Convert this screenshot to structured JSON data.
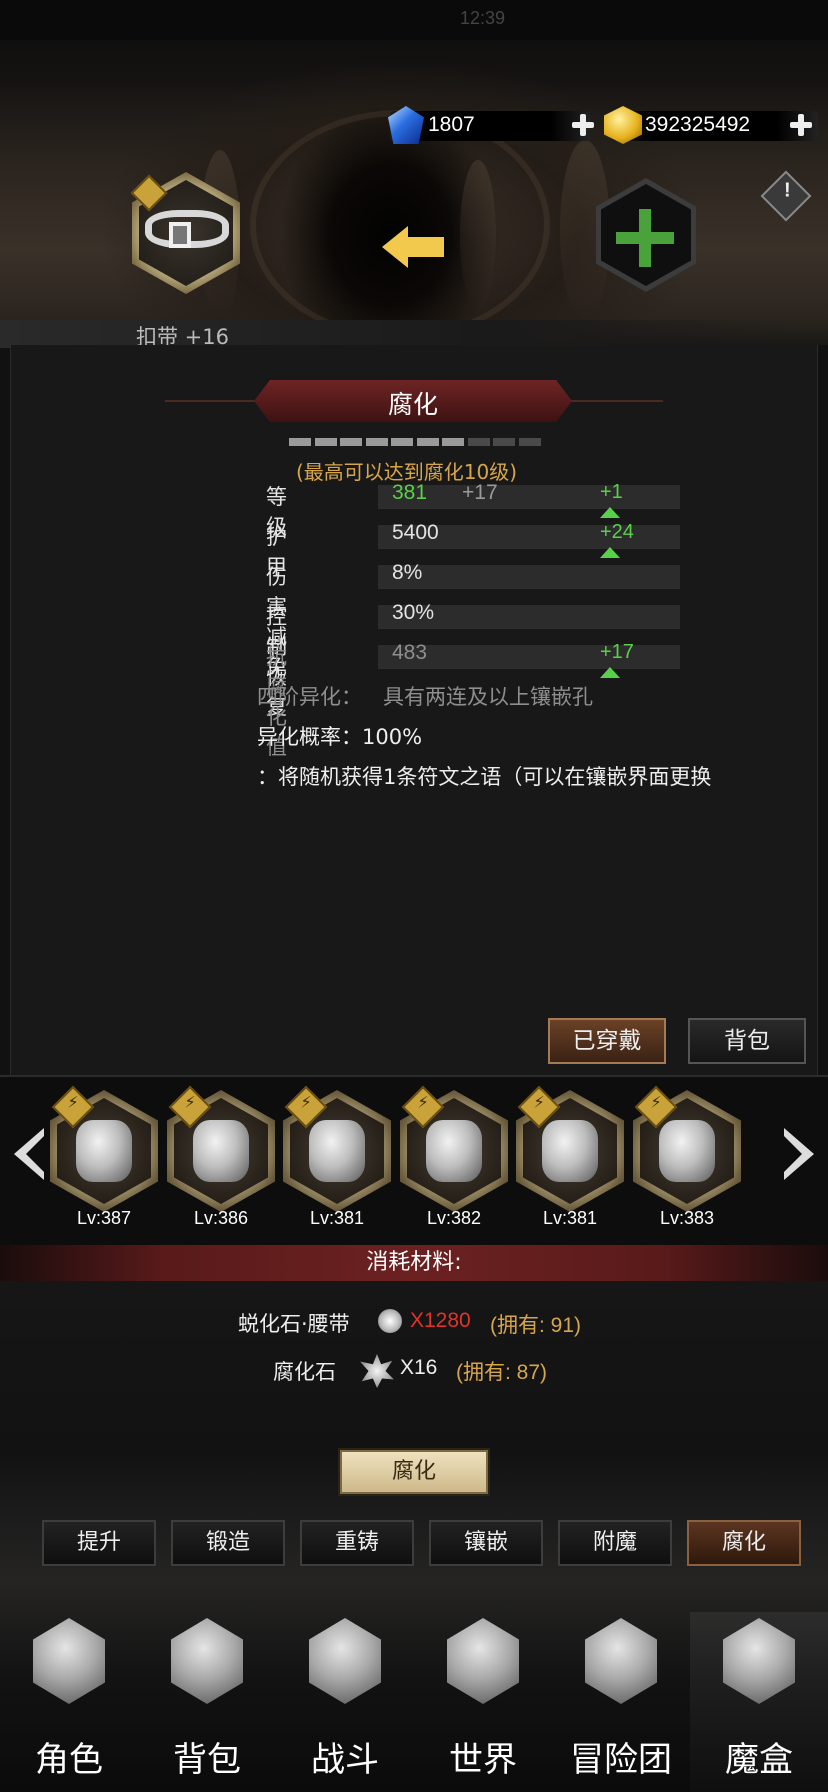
{
  "status_bar": {
    "time": "12:39"
  },
  "resources": {
    "gems": {
      "value": "1807",
      "icon": "blue-gem-icon"
    },
    "gold": {
      "value": "392325492",
      "icon": "gold-gem-icon"
    }
  },
  "equipment": {
    "name": "扣带 +16",
    "action_arrow": "left-arrow-icon",
    "add_slot": "plus-icon",
    "info": "info-icon"
  },
  "panel": {
    "title": "腐化",
    "progress": {
      "filled": 7,
      "total": 10
    },
    "max_note": "(最高可以达到腐化10级)",
    "stats": [
      {
        "label": "等级",
        "value": "381",
        "bonus": "+17",
        "up": "+1"
      },
      {
        "label": "护甲",
        "value": "5400",
        "bonus": "",
        "up": "+24"
      },
      {
        "label": "伤害减免",
        "value": "8%",
        "bonus": "",
        "up": ""
      },
      {
        "label": "控制恢复",
        "value": "30%",
        "bonus": "",
        "up": ""
      },
      {
        "label": "抗腐化值",
        "value": "483",
        "bonus": "",
        "up": "+17"
      }
    ],
    "mutation_stage": "四阶异化：",
    "mutation_req": "具有两连及以上镶嵌孔",
    "mutation_rate": "异化概率：100%",
    "mutation_desc": "：将随机获得1条符文之语（可以在镶嵌界面更换",
    "btn_equipped": "已穿戴",
    "btn_bag": "背包"
  },
  "equip_list": [
    {
      "lv": "Lv:387",
      "item": "armor"
    },
    {
      "lv": "Lv:386",
      "item": "helmet"
    },
    {
      "lv": "Lv:381",
      "item": "boots"
    },
    {
      "lv": "Lv:382",
      "item": "amulet"
    },
    {
      "lv": "Lv:381",
      "item": "belt"
    },
    {
      "lv": "Lv:383",
      "item": "cloak"
    }
  ],
  "materials": {
    "title": "消耗材料:",
    "items": [
      {
        "name": "蜕化石·腰带",
        "qty": "X1280",
        "owned": "(拥有: 91)"
      },
      {
        "name": "腐化石",
        "qty": "X16",
        "owned": "(拥有: 87)"
      }
    ],
    "action": "腐化"
  },
  "tabs": [
    "提升",
    "锻造",
    "重铸",
    "镶嵌",
    "附魔",
    "腐化"
  ],
  "nav": [
    "角色",
    "背包",
    "战斗",
    "世界",
    "冒险团",
    "魔盒"
  ]
}
